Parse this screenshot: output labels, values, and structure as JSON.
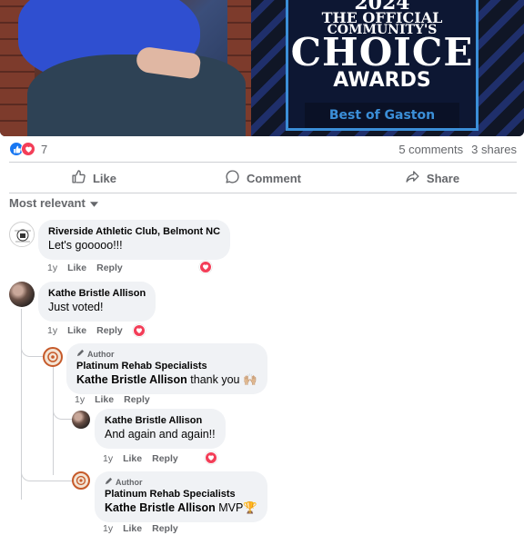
{
  "post_image": {
    "award_year": "2024",
    "award_line1": "THE OFFICIAL",
    "award_line2": "COMMUNITY'S",
    "award_line3": "CHOICE",
    "award_line4": "AWARDS",
    "award_line5": "Best of Gaston"
  },
  "reactions": {
    "count": "7",
    "comments": "5 comments",
    "shares": "3 shares"
  },
  "actions": {
    "like": "Like",
    "comment": "Comment",
    "share": "Share"
  },
  "sort_label": "Most relevant",
  "comments": [
    {
      "author": "Riverside Athletic Club, Belmont NC",
      "text": "Let's gooooo!!!",
      "time": "1y",
      "like": "Like",
      "reply": "Reply"
    },
    {
      "author": "Kathe Bristle Allison",
      "text": "Just voted!",
      "time": "1y",
      "like": "Like",
      "reply": "Reply",
      "replies": [
        {
          "tag": "Author",
          "author": "Platinum Rehab Specialists",
          "mention": "Kathe Bristle Allison",
          "text": " thank you 🙌🏼",
          "time": "1y",
          "like": "Like",
          "reply": "Reply"
        },
        {
          "author": "Kathe Bristle Allison",
          "text": "And again and again!!",
          "time": "1y",
          "like": "Like",
          "reply": "Reply"
        },
        {
          "tag": "Author",
          "author": "Platinum Rehab Specialists",
          "mention": "Kathe Bristle Allison",
          "text": " MVP🏆",
          "time": "1y",
          "like": "Like",
          "reply": "Reply"
        }
      ]
    }
  ],
  "colors": {
    "like_blue": "#1877f2",
    "love_red": "#f33e58",
    "bubble_bg": "#f0f2f5",
    "meta_gray": "#65676b"
  }
}
